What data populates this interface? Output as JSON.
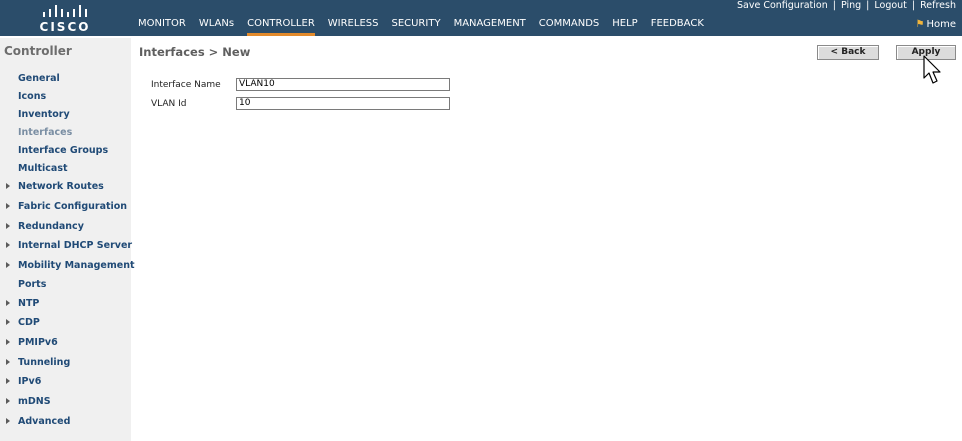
{
  "brand": {
    "logo_text": "CISCO"
  },
  "utility_links": [
    "Save Configuration",
    "Ping",
    "Logout",
    "Refresh"
  ],
  "main_nav": [
    {
      "label": "MONITOR",
      "active": false
    },
    {
      "label": "WLANs",
      "active": false
    },
    {
      "label": "CONTROLLER",
      "active": true
    },
    {
      "label": "WIRELESS",
      "active": false
    },
    {
      "label": "SECURITY",
      "active": false
    },
    {
      "label": "MANAGEMENT",
      "active": false
    },
    {
      "label": "COMMANDS",
      "active": false
    },
    {
      "label": "HELP",
      "active": false
    },
    {
      "label": "FEEDBACK",
      "active": false
    }
  ],
  "home": {
    "label": "Home",
    "icon": "home-icon"
  },
  "sidebar": {
    "title": "Controller",
    "items": [
      {
        "label": "General",
        "expandable": false,
        "active": false
      },
      {
        "label": "Icons",
        "expandable": false,
        "active": false
      },
      {
        "label": "Inventory",
        "expandable": false,
        "active": false
      },
      {
        "label": "Interfaces",
        "expandable": false,
        "active": true
      },
      {
        "label": "Interface Groups",
        "expandable": false,
        "active": false
      },
      {
        "label": "Multicast",
        "expandable": false,
        "active": false
      },
      {
        "label": "Network Routes",
        "expandable": true,
        "active": false
      },
      {
        "label": "Fabric Configuration",
        "expandable": true,
        "active": false
      },
      {
        "label": "Redundancy",
        "expandable": true,
        "active": false
      },
      {
        "label": "Internal DHCP Server",
        "expandable": true,
        "active": false
      },
      {
        "label": "Mobility Management",
        "expandable": true,
        "active": false
      },
      {
        "label": "Ports",
        "expandable": false,
        "active": false
      },
      {
        "label": "NTP",
        "expandable": true,
        "active": false
      },
      {
        "label": "CDP",
        "expandable": true,
        "active": false
      },
      {
        "label": "PMIPv6",
        "expandable": true,
        "active": false
      },
      {
        "label": "Tunneling",
        "expandable": true,
        "active": false
      },
      {
        "label": "IPv6",
        "expandable": true,
        "active": false
      },
      {
        "label": "mDNS",
        "expandable": true,
        "active": false
      },
      {
        "label": "Advanced",
        "expandable": true,
        "active": false
      }
    ]
  },
  "page": {
    "title": "Interfaces > New",
    "back_label": "< Back",
    "apply_label": "Apply",
    "fields": [
      {
        "label": "Interface Name",
        "value": "VLAN10"
      },
      {
        "label": "VLAN Id",
        "value": "10"
      }
    ]
  },
  "colors": {
    "header_bg": "#2b4d6a",
    "active_tab_underline": "#e28a2b",
    "sidebar_bg": "#f0f0f0",
    "sidebar_link": "#204a76"
  }
}
